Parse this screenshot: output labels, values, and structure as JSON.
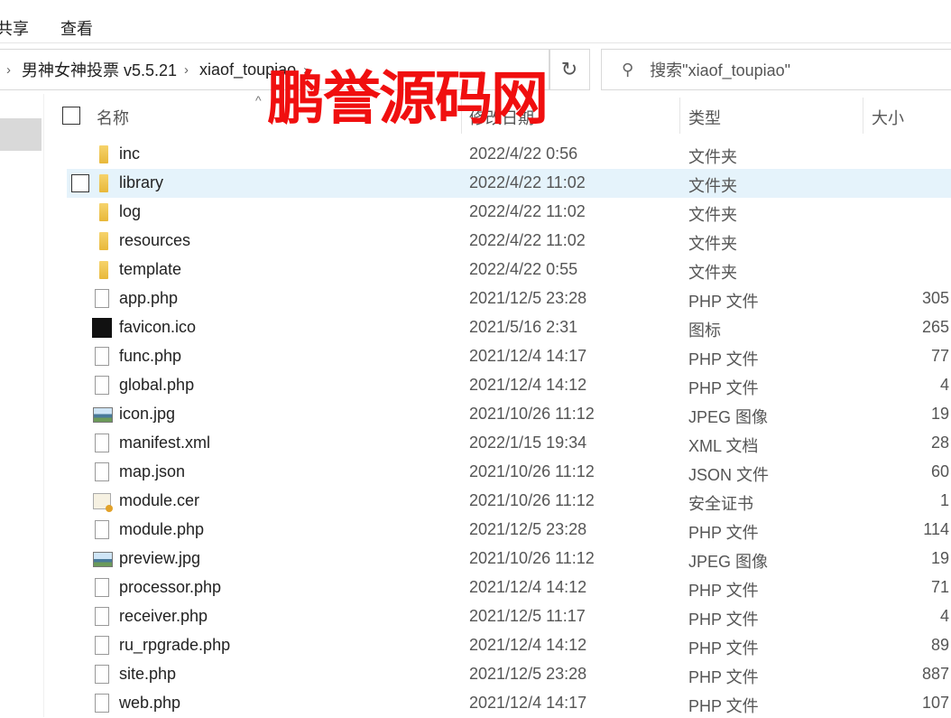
{
  "menu": {
    "share": "共享",
    "view": "查看"
  },
  "address": {
    "crumbs": [
      "男神女神投票 v5.5.21",
      "xiaof_toupiao"
    ]
  },
  "search": {
    "placeholder": "搜索\"xiaof_toupiao\""
  },
  "columns": {
    "name": "名称",
    "date": "修改日期",
    "type": "类型",
    "size": "大小"
  },
  "watermark": "鹏誉源码网",
  "files": [
    {
      "name": "inc",
      "date": "2022/4/22 0:56",
      "type": "文件夹",
      "size": "",
      "icon": "folder"
    },
    {
      "name": "library",
      "date": "2022/4/22 11:02",
      "type": "文件夹",
      "size": "",
      "icon": "folder",
      "selected": true
    },
    {
      "name": "log",
      "date": "2022/4/22 11:02",
      "type": "文件夹",
      "size": "",
      "icon": "folder"
    },
    {
      "name": "resources",
      "date": "2022/4/22 11:02",
      "type": "文件夹",
      "size": "",
      "icon": "folder"
    },
    {
      "name": "template",
      "date": "2022/4/22 0:55",
      "type": "文件夹",
      "size": "",
      "icon": "folder"
    },
    {
      "name": "app.php",
      "date": "2021/12/5 23:28",
      "type": "PHP 文件",
      "size": "305",
      "icon": "file"
    },
    {
      "name": "favicon.ico",
      "date": "2021/5/16 2:31",
      "type": "图标",
      "size": "265",
      "icon": "ico"
    },
    {
      "name": "func.php",
      "date": "2021/12/4 14:17",
      "type": "PHP 文件",
      "size": "77",
      "icon": "file"
    },
    {
      "name": "global.php",
      "date": "2021/12/4 14:12",
      "type": "PHP 文件",
      "size": "4",
      "icon": "file"
    },
    {
      "name": "icon.jpg",
      "date": "2021/10/26 11:12",
      "type": "JPEG 图像",
      "size": "19",
      "icon": "img"
    },
    {
      "name": "manifest.xml",
      "date": "2022/1/15 19:34",
      "type": "XML 文档",
      "size": "28",
      "icon": "file"
    },
    {
      "name": "map.json",
      "date": "2021/10/26 11:12",
      "type": "JSON 文件",
      "size": "60",
      "icon": "file"
    },
    {
      "name": "module.cer",
      "date": "2021/10/26 11:12",
      "type": "安全证书",
      "size": "1",
      "icon": "cert"
    },
    {
      "name": "module.php",
      "date": "2021/12/5 23:28",
      "type": "PHP 文件",
      "size": "114",
      "icon": "file"
    },
    {
      "name": "preview.jpg",
      "date": "2021/10/26 11:12",
      "type": "JPEG 图像",
      "size": "19",
      "icon": "img"
    },
    {
      "name": "processor.php",
      "date": "2021/12/4 14:12",
      "type": "PHP 文件",
      "size": "71",
      "icon": "file"
    },
    {
      "name": "receiver.php",
      "date": "2021/12/5 11:17",
      "type": "PHP 文件",
      "size": "4",
      "icon": "file"
    },
    {
      "name": "ru_rpgrade.php",
      "date": "2021/12/4 14:12",
      "type": "PHP 文件",
      "size": "89",
      "icon": "file"
    },
    {
      "name": "site.php",
      "date": "2021/12/5 23:28",
      "type": "PHP 文件",
      "size": "887",
      "icon": "file"
    },
    {
      "name": "web.php",
      "date": "2021/12/4 14:17",
      "type": "PHP 文件",
      "size": "107",
      "icon": "file"
    }
  ]
}
